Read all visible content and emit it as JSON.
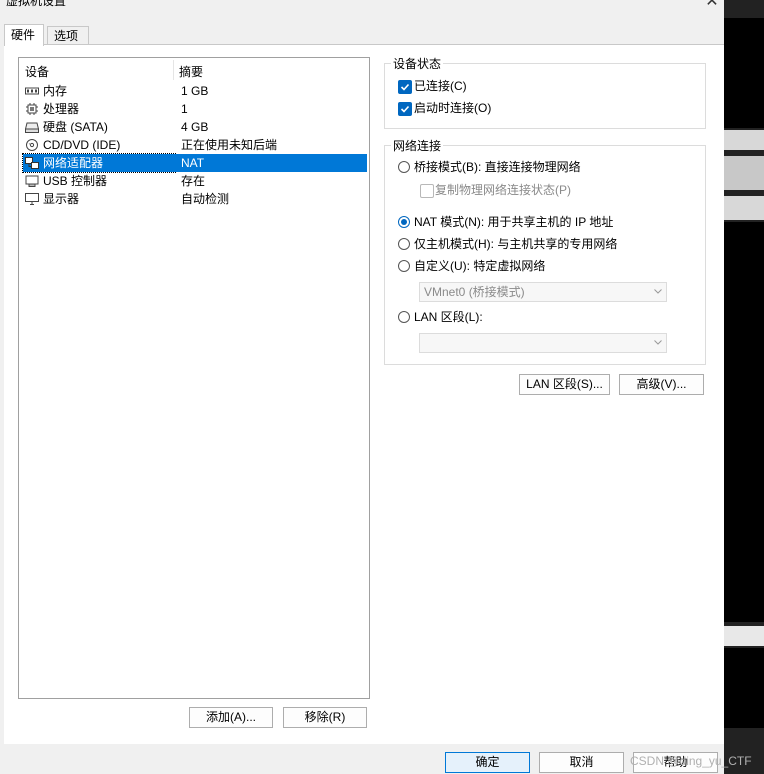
{
  "window": {
    "title": "虚拟机设置",
    "close_glyph": "✕"
  },
  "tabs": [
    {
      "label": "硬件"
    },
    {
      "label": "选项"
    }
  ],
  "device_list": {
    "headers": {
      "device": "设备",
      "summary": "摘要"
    },
    "rows": [
      {
        "icon": "memory-icon",
        "name": "内存",
        "summary": "1 GB"
      },
      {
        "icon": "cpu-icon",
        "name": "处理器",
        "summary": "1"
      },
      {
        "icon": "harddisk-icon",
        "name": "硬盘 (SATA)",
        "summary": "4 GB"
      },
      {
        "icon": "cd-dvd-icon",
        "name": "CD/DVD (IDE)",
        "summary": "正在使用未知后端"
      },
      {
        "icon": "network-adapter-icon",
        "name": "网络适配器",
        "summary": "NAT"
      },
      {
        "icon": "usb-icon",
        "name": "USB 控制器",
        "summary": "存在"
      },
      {
        "icon": "display-icon",
        "name": "显示器",
        "summary": "自动检测"
      }
    ],
    "selected_index": 4,
    "add_button": "添加(A)...",
    "remove_button": "移除(R)"
  },
  "device_status": {
    "legend": "设备状态",
    "connected": {
      "label": "已连接(C)",
      "checked": true
    },
    "connect_at_power_on": {
      "label": "启动时连接(O)",
      "checked": true
    }
  },
  "network_connection": {
    "legend": "网络连接",
    "bridged": {
      "label": "桥接模式(B): 直接连接物理网络",
      "selected": false
    },
    "replicate_state": {
      "label": "复制物理网络连接状态(P)",
      "checked": false
    },
    "nat": {
      "label": "NAT 模式(N): 用于共享主机的 IP 地址",
      "selected": true
    },
    "host_only": {
      "label": "仅主机模式(H): 与主机共享的专用网络",
      "selected": false
    },
    "custom": {
      "label": "自定义(U): 特定虚拟网络",
      "selected": false
    },
    "custom_select_value": "VMnet0 (桥接模式)",
    "lan_segment": {
      "label": "LAN 区段(L):",
      "selected": false
    },
    "lan_select_value": ""
  },
  "buttons": {
    "lan_segments": "LAN 区段(S)...",
    "advanced": "高级(V)...",
    "ok": "确定",
    "cancel": "取消",
    "help": "帮助"
  },
  "watermark": "CSDN @ding_yu_CTF",
  "colors": {
    "accent": "#0067c0",
    "selection": "#0078d7"
  }
}
